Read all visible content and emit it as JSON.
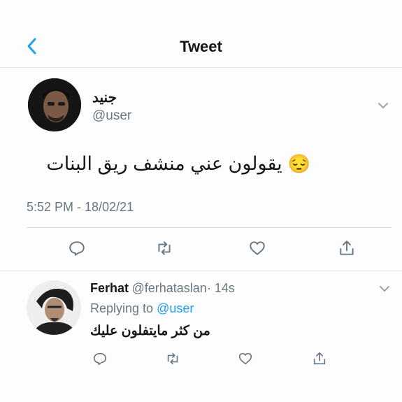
{
  "header": {
    "title": "Tweet"
  },
  "tweet": {
    "author_name": "جنيد",
    "author_handle": "@user",
    "text": "يقولون عني منشف ريق البنات",
    "emoji": "😔",
    "timestamp": "5:52 PM - 18/02/21"
  },
  "reply": {
    "author_name": "Ferhat",
    "author_handle": "@ferhataslan",
    "time": "· 14s",
    "replying_to_prefix": "Replying to ",
    "replying_to_handle": "@user",
    "text": "من كثر مايتفلون عليك"
  },
  "colors": {
    "accent": "#1da1f2",
    "text": "#14171a",
    "secondary": "#6b7780",
    "divider": "#e3e6e8"
  },
  "icons": [
    "back-chevron-icon",
    "chevron-down-icon",
    "reply-icon",
    "retweet-icon",
    "like-icon",
    "share-icon"
  ]
}
